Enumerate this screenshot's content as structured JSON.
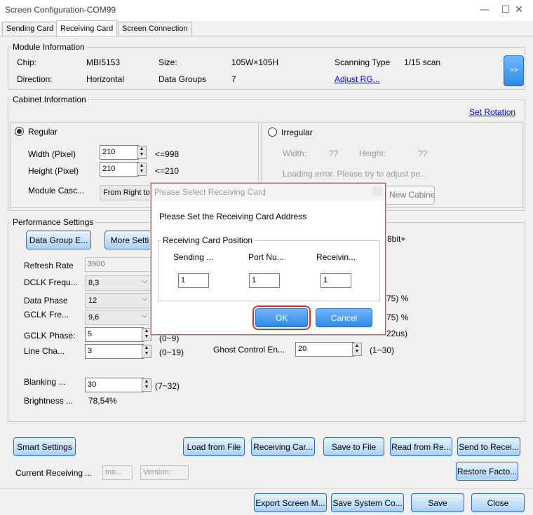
{
  "window": {
    "title": "Screen Configuration-COM99",
    "minimize": "—",
    "maximize": "☐",
    "close": "✕"
  },
  "tabs": [
    "Sending Card",
    "Receiving Card",
    "Screen Connection"
  ],
  "module_info": {
    "legend": "Module Information",
    "chip_label": "Chip:",
    "chip_value": "MBI5153",
    "size_label": "Size:",
    "size_value": "105W×105H",
    "scan_label": "Scanning Type",
    "scan_value": "1/15 scan",
    "direction_label": "Direction:",
    "direction_value": "Horizontal",
    "groups_label": "Data Groups",
    "groups_value": "7",
    "adjust_link": "Adjust RG...",
    "more_button": ">>"
  },
  "cabinet_info": {
    "legend": "Cabinet Information",
    "set_rotation": "Set Rotation",
    "regular": {
      "label": "Regular",
      "width_label": "Width (Pixel)",
      "width_value": "210",
      "width_limit": "<=998",
      "height_label": "Height (Pixel)",
      "height_value": "210",
      "height_limit": "<=210",
      "cascade_label": "Module Casc...",
      "cascade_value": "From Right to"
    },
    "irregular": {
      "label": "Irregular",
      "width_label": "Width:",
      "width_value": "??",
      "height_label": "Height:",
      "height_value": "??",
      "error_text": "Loading error. Please try to adjust pe...",
      "new_cabinet_button": "New Cabinet"
    }
  },
  "performance": {
    "legend": "Performance Settings",
    "data_group_button": "Data Group E...",
    "more_settings_button": "More Setti",
    "bit_text": "8bit+",
    "refresh_label": "Refresh Rate",
    "refresh_value": "3900",
    "dclk_label": "DCLK Frequ...",
    "dclk_value": "8,3",
    "data_phase_label": "Data Phase",
    "data_phase_value": "12",
    "pct1": "75) %",
    "gclk_freq_label": "GCLK Fre...",
    "gclk_freq_value": "9,6",
    "pct2": "75) %",
    "gclk_phase_label": "GCLK Phase:",
    "gclk_phase_value": "5",
    "gclk_phase_range": "(0~9)",
    "us_text": "22us)",
    "line_label": "Line Cha...",
    "line_value": "3",
    "line_range": "(0~19)",
    "ghost_label": "Ghost Control En...",
    "ghost_value": "20",
    "ghost_range": "(1~30)",
    "blanking_label": "Blanking ...",
    "blanking_value": "30",
    "blanking_range": "(7~32)",
    "brightness_label": "Brightness ...",
    "brightness_value": "78,54%"
  },
  "bottom": {
    "smart_settings": "Smart Settings",
    "load_from_file": "Load from File",
    "receiving_card": "Receiving Car...",
    "save_to_file": "Save to File",
    "read_from": "Read from Re...",
    "send_to": "Send to Recei...",
    "current_receiving_label": "Current Receiving ...",
    "mode_placeholder": "mo...",
    "version_placeholder": "Version:",
    "restore": "Restore Facto...",
    "export": "Export Screen M...",
    "save_system": "Save System Co...",
    "save": "Save",
    "close": "Close"
  },
  "dialog": {
    "title": "Please Select Receiving Card",
    "message": "Please Set the Receiving Card Address",
    "legend": "Receiving Card Position",
    "col1": "Sending ...",
    "col2": "Port Nu...",
    "col3": "Receivin...",
    "val1": "1",
    "val2": "1",
    "val3": "1",
    "ok": "OK",
    "cancel": "Cancel"
  }
}
